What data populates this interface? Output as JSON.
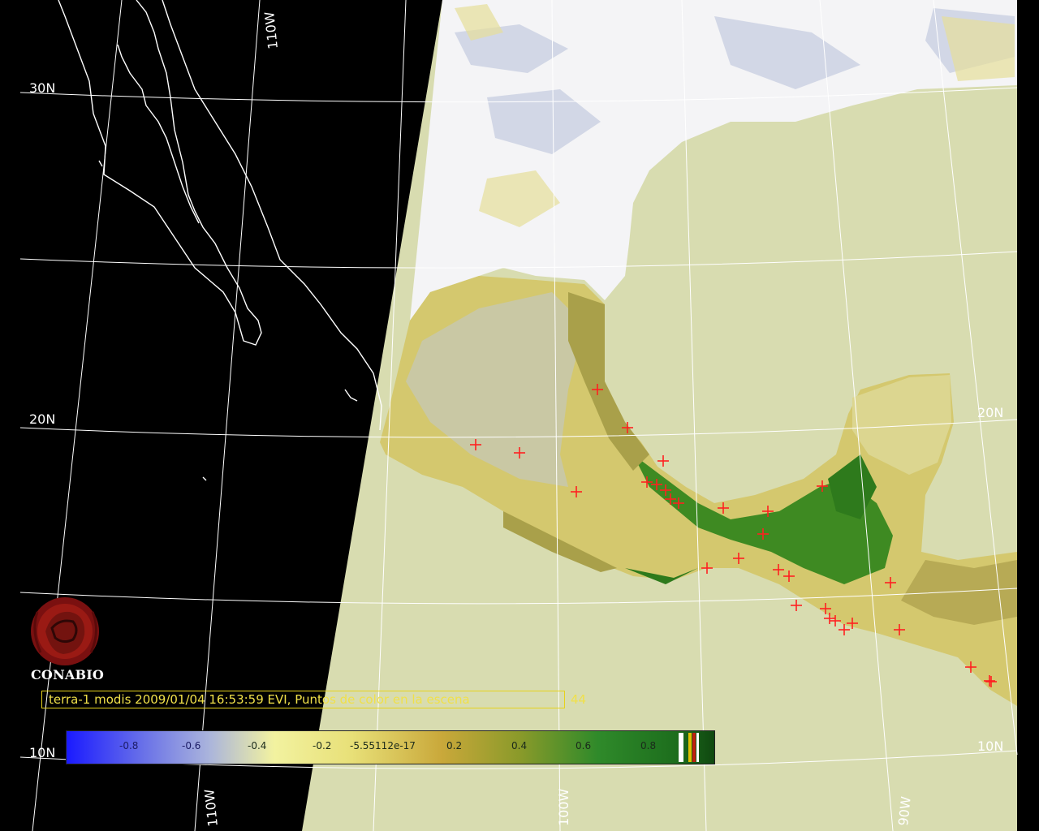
{
  "map": {
    "graticule_labels": {
      "lat": [
        "30N",
        "20N",
        "10N"
      ],
      "lat_right": [
        "20N",
        "10N"
      ],
      "lon_top": [
        "110W"
      ],
      "lon_bottom": [
        "110W",
        "100W",
        "90W"
      ]
    }
  },
  "logo": {
    "name": "CONABIO",
    "label": "CONABIO"
  },
  "caption": {
    "text": "terra-1 modis 2009/01/04 16:53:59 EVI, Puntos de color en la escena",
    "count": "44"
  },
  "colorbar": {
    "labels": [
      "-0.8",
      "-0.6",
      "-0.4",
      "-0.2",
      "-5.55112e-17",
      "0.2",
      "0.4",
      "0.6",
      "0.8"
    ],
    "colors": {
      "low": "#1a1aff",
      "mid_low": "#f2f2a0",
      "mid": "#c9a83a",
      "high": "#104810",
      "extra": [
        "#ffffff",
        "#e0c000",
        "#c02010",
        "#ffffff"
      ]
    }
  },
  "colors": {
    "background": "#000000",
    "ocean": "#d8dcb0",
    "cloud": "#ffffff",
    "land_dry": "#d6c970",
    "land_green": "#3f8a22",
    "fire_mark": "#ff2020",
    "coastline": "#ffffff"
  }
}
